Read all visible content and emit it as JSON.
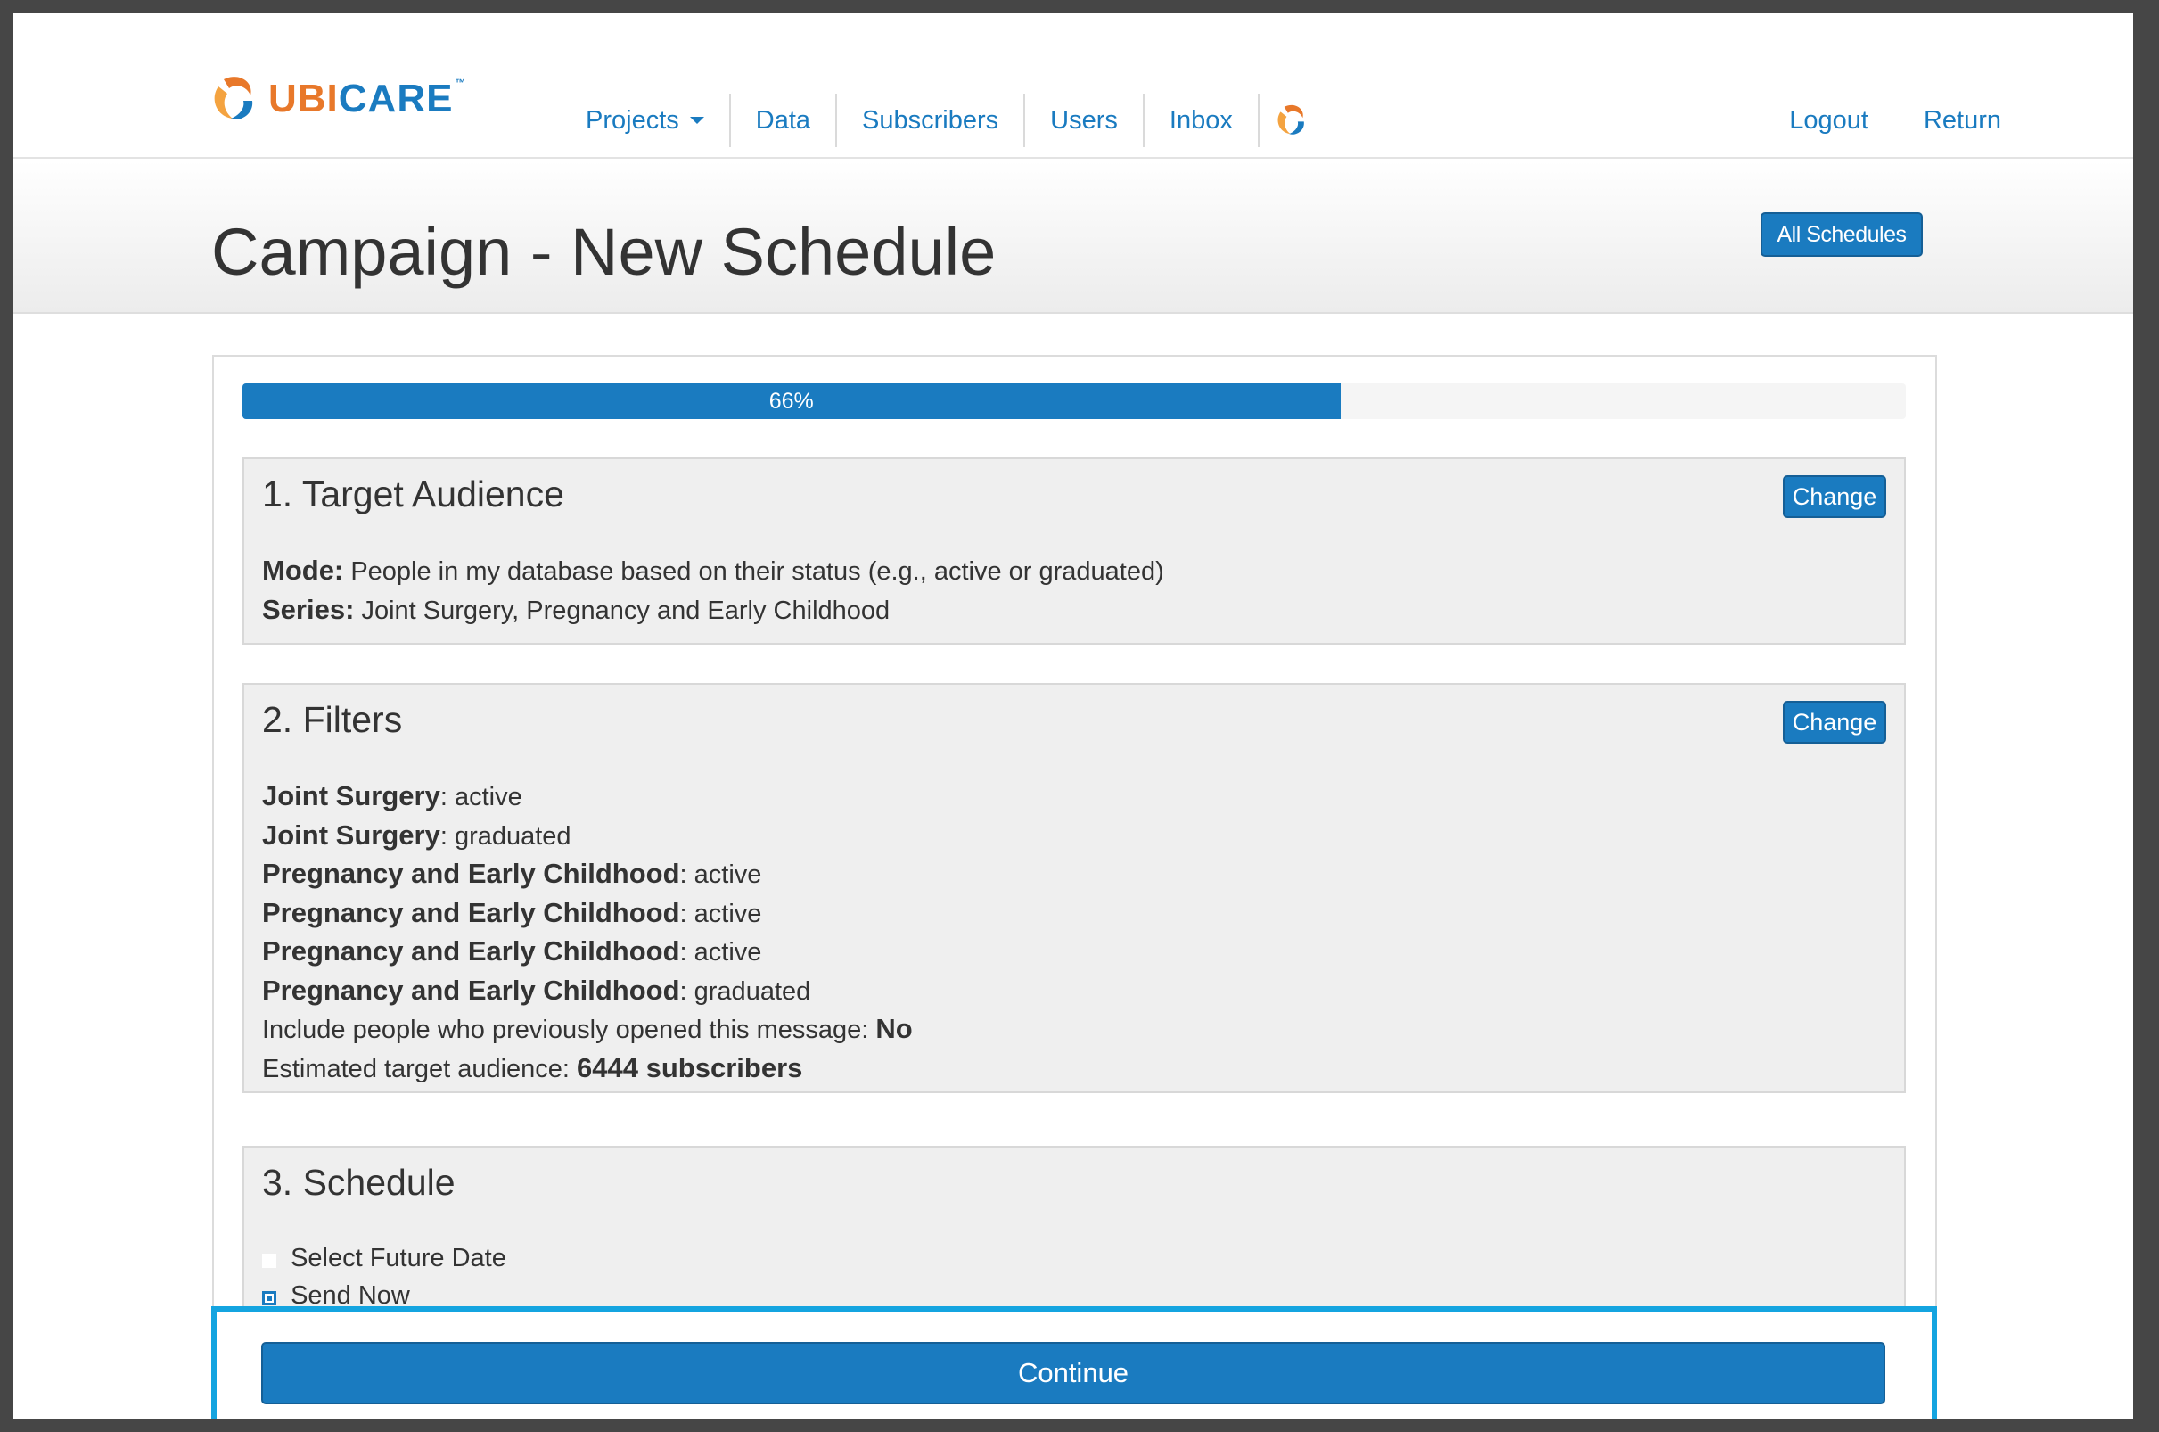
{
  "brand": {
    "ubi": "Ubi",
    "care": "Care",
    "tm": "™"
  },
  "nav": {
    "projects": "Projects",
    "data": "Data",
    "subscribers": "Subscribers",
    "users": "Users",
    "inbox": "Inbox",
    "logout": "Logout",
    "return": "Return"
  },
  "page": {
    "title": "Campaign - New Schedule",
    "all_schedules": "All Schedules"
  },
  "progress": {
    "label": "66%",
    "value": 66
  },
  "target_audience": {
    "title": "1. Target Audience",
    "change": "Change",
    "mode_label": "Mode:",
    "mode_value": "People in my database based on their status (e.g., active or graduated)",
    "series_label": "Series:",
    "series_value": "Joint Surgery, Pregnancy and Early Childhood"
  },
  "filters": {
    "title": "2. Filters",
    "change": "Change",
    "items": [
      {
        "series": "Joint Surgery",
        "status": ": active"
      },
      {
        "series": "Joint Surgery",
        "status": ": graduated"
      },
      {
        "series": "Pregnancy and Early Childhood",
        "status": ": active"
      },
      {
        "series": "Pregnancy and Early Childhood",
        "status": ": active"
      },
      {
        "series": "Pregnancy and Early Childhood",
        "status": ": active"
      },
      {
        "series": "Pregnancy and Early Childhood",
        "status": ": graduated"
      }
    ],
    "include_label": "Include people who previously opened this message:",
    "include_value": "No",
    "estimate_label": "Estimated target audience:",
    "estimate_value": "6444 subscribers"
  },
  "schedule": {
    "title": "3. Schedule",
    "option_future": "Select Future Date",
    "option_now": "Send Now",
    "selected": "Send Now"
  },
  "continue": "Continue",
  "colors": {
    "primary": "#1a7bc0",
    "accent_orange": "#e8782a",
    "highlight": "#14a4e0"
  },
  "icons": {
    "logo": "ubicare-logo-icon",
    "nav_logo": "ubicare-swirl-icon",
    "dropdown": "caret-down-icon"
  }
}
